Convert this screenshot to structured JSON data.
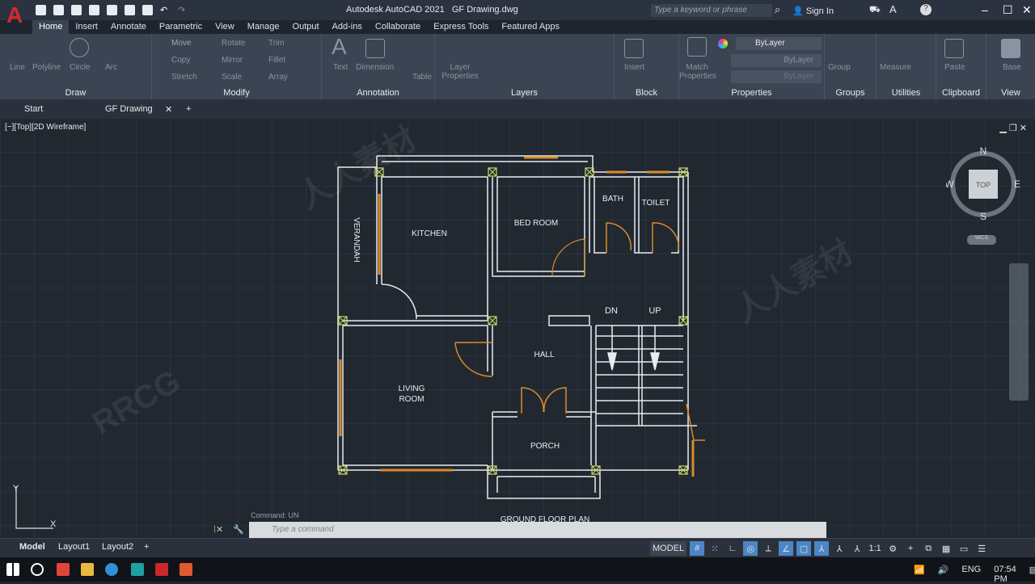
{
  "app": {
    "title": "Autodesk AutoCAD 2021",
    "file": "GF Drawing.dwg",
    "search_placeholder": "Type a keyword or phrase",
    "sign_in": "Sign In"
  },
  "ribbon_tabs": [
    "Home",
    "Insert",
    "Annotate",
    "Parametric",
    "View",
    "Manage",
    "Output",
    "Add-ins",
    "Collaborate",
    "Express Tools",
    "Featured Apps"
  ],
  "panels": {
    "draw": {
      "title": "Draw",
      "tools": [
        "Line",
        "Polyline",
        "Circle",
        "Arc"
      ]
    },
    "modify": {
      "title": "Modify",
      "tools": [
        "Move",
        "Rotate",
        "Trim",
        "Copy",
        "Mirror",
        "Fillet",
        "Stretch",
        "Scale",
        "Array"
      ]
    },
    "annotation": {
      "title": "Annotation",
      "tools": [
        "Text",
        "Dimension",
        "Table"
      ]
    },
    "layers": {
      "title": "Layers",
      "tools": [
        "Layer Properties"
      ]
    },
    "block": {
      "title": "Block",
      "tools": [
        "Insert"
      ]
    },
    "properties": {
      "title": "Properties",
      "tools": [
        "Match Properties"
      ],
      "color": "ByLayer",
      "linetype": "ByLayer",
      "lineweight": "ByLayer"
    },
    "groups": {
      "title": "Groups",
      "tools": [
        "Group"
      ]
    },
    "utilities": {
      "title": "Utilities",
      "tools": [
        "Measure"
      ]
    },
    "clipboard": {
      "title": "Clipboard",
      "tools": [
        "Paste"
      ]
    },
    "view": {
      "title": "View",
      "tools": [
        "Base"
      ]
    }
  },
  "doc_tabs": {
    "start": "Start",
    "active": "GF Drawing",
    "add": "+"
  },
  "viewport": {
    "label": "[−][Top][2D Wireframe]",
    "viewcube": {
      "top": "TOP",
      "n": "N",
      "s": "S",
      "e": "E",
      "w": "W",
      "wcs": "WCS"
    }
  },
  "plan": {
    "rooms": {
      "verandah": "VERANDAH",
      "kitchen": "KITCHEN",
      "bedroom": "BED ROOM",
      "bath": "BATH",
      "toilet": "TOILET",
      "dn": "DN",
      "up": "UP",
      "hall": "HALL",
      "living1": "LIVING",
      "living2": "ROOM",
      "porch": "PORCH"
    },
    "title": "GROUND FLOOR PLAN"
  },
  "ucs": {
    "x": "X",
    "y": "Y"
  },
  "command": {
    "placeholder": "Type a command",
    "history": "Command:  UN"
  },
  "layout_tabs": [
    "Model",
    "Layout1",
    "Layout2"
  ],
  "status": {
    "model": "MODEL",
    "scale": "1:1"
  },
  "tray": {
    "lang": "ENG",
    "time": "07:54 PM"
  },
  "colors": {
    "accent": "#4c86c6",
    "wall": "#e8ecf2",
    "window": "#d98a2b",
    "column": "#c9d66a",
    "logo": "#d8272e"
  }
}
